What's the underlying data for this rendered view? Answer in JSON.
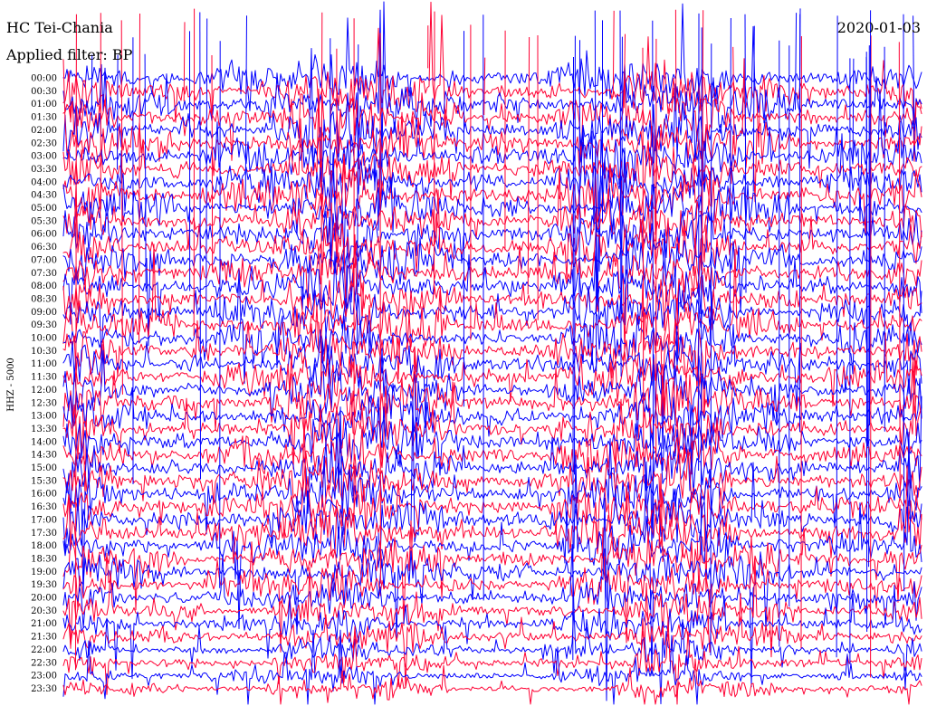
{
  "chart_data": {
    "type": "line",
    "title": "HC Tei-Chania",
    "subtitle": "Applied filter: BP",
    "date": "2020-01-03",
    "ylabel": "HHZ - 5000",
    "y_ticks": [
      "00:00",
      "00:30",
      "01:00",
      "01:30",
      "02:00",
      "02:30",
      "03:00",
      "03:30",
      "04:00",
      "04:30",
      "05:00",
      "05:30",
      "06:00",
      "06:30",
      "07:00",
      "07:30",
      "08:00",
      "08:30",
      "09:00",
      "09:30",
      "10:00",
      "10:30",
      "11:00",
      "11:30",
      "12:00",
      "12:30",
      "13:00",
      "13:30",
      "14:00",
      "14:30",
      "15:00",
      "15:30",
      "16:00",
      "16:30",
      "17:00",
      "17:30",
      "18:00",
      "18:30",
      "19:00",
      "19:30",
      "20:00",
      "20:30",
      "21:00",
      "21:30",
      "22:00",
      "22:30",
      "23:00",
      "23:30"
    ],
    "grid": false,
    "series_colors": [
      "#0000ff",
      "#ff0033"
    ],
    "trace_count": 48
  }
}
